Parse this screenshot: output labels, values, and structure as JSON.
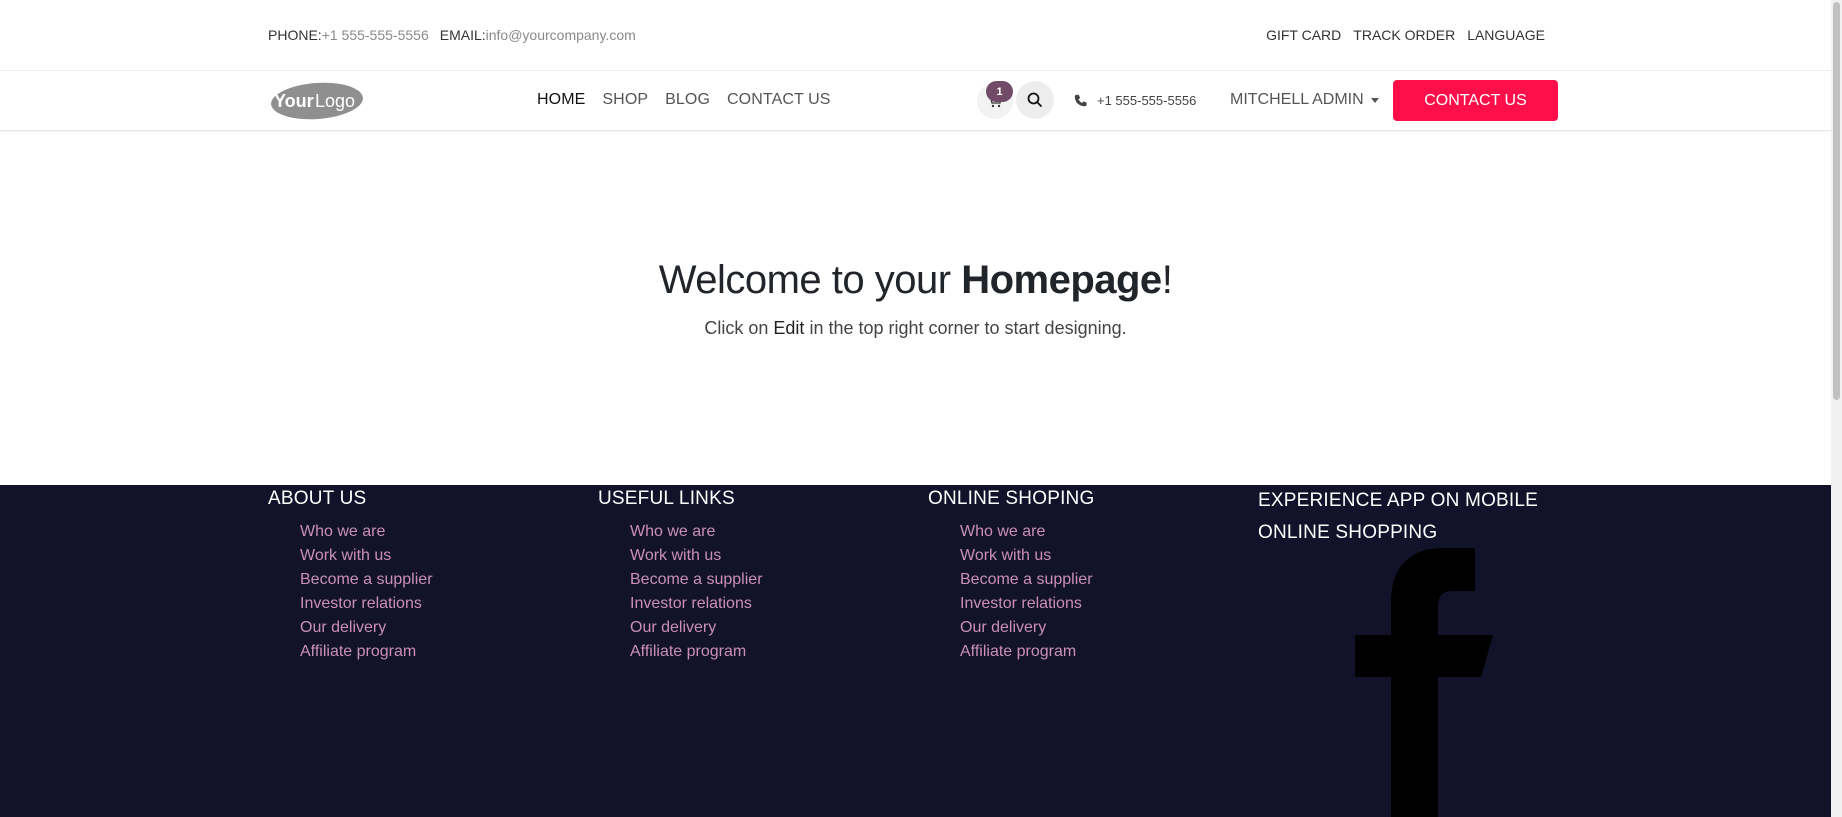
{
  "topbar": {
    "phone_label": "PHONE:",
    "phone_value": "+1 555-555-5556",
    "email_label": "EMAIL:",
    "email_value": "info@yourcompany.com",
    "links": [
      "GIFT CARD",
      "TRACK ORDER",
      "LANGUAGE"
    ]
  },
  "navbar": {
    "logo_text": "YourLogo",
    "links": [
      "HOME",
      "SHOP",
      "BLOG",
      "CONTACT US"
    ],
    "cart_count": "1",
    "phone": "+1 555-555-5556",
    "user": "MITCHELL ADMIN",
    "cta": "CONTACT US"
  },
  "hero": {
    "title_normal": "Welcome to your ",
    "title_bold": "Homepage",
    "title_end": "!",
    "subtitle_start": "Click on ",
    "subtitle_bold": "Edit",
    "subtitle_end": " in the top right corner to start designing."
  },
  "footer": {
    "columns": [
      {
        "title": "ABOUT US",
        "items": [
          "Who we are",
          "Work with us",
          "Become a supplier",
          "Investor relations",
          "Our delivery",
          "Affiliate program"
        ]
      },
      {
        "title": "USEFUL LINKS",
        "items": [
          "Who we are",
          "Work with us",
          "Become a supplier",
          "Investor relations",
          "Our delivery",
          "Affiliate program"
        ]
      },
      {
        "title": "ONLINE SHOPING",
        "items": [
          "Who we are",
          "Work with us",
          "Become a supplier",
          "Investor relations",
          "Our delivery",
          "Affiliate program"
        ]
      }
    ],
    "app_title_1": "EXPERIENCE APP ON MOBILE",
    "app_title_2": "ONLINE SHOPPING",
    "social_icon": "facebook-icon"
  },
  "colors": {
    "accent": "#ff0f4a",
    "footer_bg": "#12132a",
    "footer_link": "#c98fb8",
    "badge": "#714b67"
  }
}
